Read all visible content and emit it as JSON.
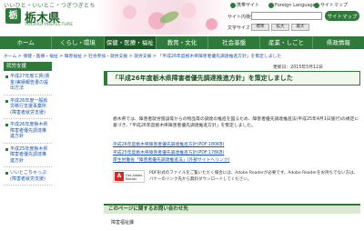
{
  "header": {
    "catchphrase": "いいひと・いいとこ・つぎつぎとちぎ",
    "logo_mark": "栃",
    "logo_text": "栃木県",
    "logo_sub": "TOCHIGI PREFECTURE",
    "utility": {
      "mobile": "携帯サイト",
      "language": "Foreign Language",
      "sitemap": "サイトマップ"
    },
    "search": {
      "label": "サイト内検索",
      "placeholder": "",
      "button": "サイトマップ"
    },
    "font_size": {
      "label": "文字サイズ",
      "small": "標準",
      "medium": "拡大",
      "large": "最大"
    }
  },
  "nav": {
    "items": [
      {
        "label": "ホーム"
      },
      {
        "label": "くらし・環境"
      },
      {
        "label": "保健・医療・福祉"
      },
      {
        "label": "教育・文化"
      },
      {
        "label": "社会基盤"
      },
      {
        "label": "産業・しごと"
      },
      {
        "label": "県政情報"
      }
    ],
    "active_index": 2
  },
  "breadcrumb": "ホーム > 保健・医療・福祉 > 障害福祉 > 社会参加・就労支援 > 就労支援 > 「平成26年度栃木県障害者優先調達推進方針」を策定しました",
  "sidebar": {
    "heading": "就労支援",
    "items": [
      {
        "label": "平成27年度工賃(賃金)実績報告書の提出方法"
      },
      {
        "label": "平成26年度一般就労移行支援事業所(障害者就労支援)"
      },
      {
        "label": "平成26年度栃木県障害者優先調達推進方針"
      },
      {
        "label": "平成25年度栃木県障害者優先調達推進方針"
      },
      {
        "label": "いいとこちゃっぷ(障害者就労支援)"
      }
    ]
  },
  "main": {
    "updated": "更新日：2015年5月12日",
    "title": "「平成26年度栃木県障害者優先調達推進方針」を策定しました",
    "body": "栃木県では、障害者就労施設等からの物品等の調達の推進を図るため、障害者優先調達推進法(平成25年4月1日施行)の規定に基づき、「平成26年度栃木県障害者優先調達推進方針」を策定しました。",
    "links": [
      {
        "label": "平成26年度栃木県障害者優先調達推進方針(PDF:180KB)"
      },
      {
        "label": "平成25年度栃木県障害者優先調達推進方針(PDF:178KB)"
      },
      {
        "label": "厚生労働省「障害者優先調達推進法」(外部サイトへリンク)"
      }
    ],
    "pdf_badge": "Get Adobe Reader",
    "reader_note": "PDF形式のファイルをご覧いただく場合には、Adobe Readerが必要です。Adobe Readerをお持ちでない方は、バナーのリンク先から無料ダウンロードしてください。",
    "contact_heading": "このページに関するお問い合わせ先",
    "contact_dept": "障害福祉課"
  },
  "colors": {
    "brand_green": "#2f7a3a",
    "dark_green": "#1e5a26",
    "link_blue": "#1a55a8"
  }
}
